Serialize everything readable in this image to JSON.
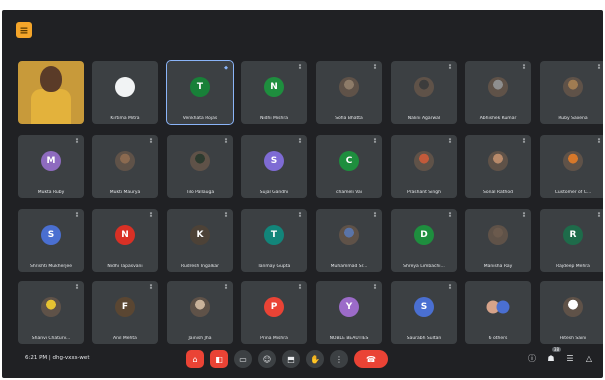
{
  "app": {
    "logo_glyph": "≡"
  },
  "participants": [
    {
      "name": "",
      "initial": "",
      "color": "",
      "type": "self",
      "mic": ""
    },
    {
      "name": "Kirtima Mitra",
      "initial": "",
      "color": "#f1f3f4",
      "type": "white",
      "mic": ""
    },
    {
      "name": "Venkhata Rojas",
      "initial": "T",
      "color": "#188038",
      "type": "initial",
      "mic": "◆",
      "active": true
    },
    {
      "name": "Nidhi Mishra",
      "initial": "N",
      "color": "#1e8e3e",
      "type": "initial",
      "mic": "⁑"
    },
    {
      "name": "Sofia Bhatta",
      "initial": "",
      "color": "#8d7b68",
      "type": "photo",
      "mic": "⁑"
    },
    {
      "name": "Nalini Agarwal",
      "initial": "",
      "color": "#3c3c3c",
      "type": "photo",
      "mic": "⁑"
    },
    {
      "name": "Abhishek Kumar",
      "initial": "",
      "color": "#8e8e8e",
      "type": "photo",
      "mic": "⁑"
    },
    {
      "name": "Ruby Saxena",
      "initial": "",
      "color": "#a07c52",
      "type": "photo",
      "mic": "⁑"
    },
    {
      "name": "Mukta Ruby",
      "initial": "M",
      "color": "#8e6bbf",
      "type": "initial",
      "mic": "⁑"
    },
    {
      "name": "Mukti Maurya",
      "initial": "",
      "color": "#8b6a50",
      "type": "photo",
      "mic": "⁑"
    },
    {
      "name": "Tilo Pallauga",
      "initial": "",
      "color": "#2d3b2f",
      "type": "photo",
      "mic": "⁑"
    },
    {
      "name": "Sujal Gandhi",
      "initial": "S",
      "color": "#7e6bd4",
      "type": "initial",
      "mic": "⁑"
    },
    {
      "name": "chameli Vai",
      "initial": "C",
      "color": "#1e8e3e",
      "type": "initial",
      "mic": "⁑"
    },
    {
      "name": "Prashant Singh",
      "initial": "",
      "color": "#c35a3a",
      "type": "photo",
      "mic": "⁑"
    },
    {
      "name": "Sonal Rathod",
      "initial": "",
      "color": "#b88a6a",
      "type": "photo",
      "mic": "⁑"
    },
    {
      "name": "Customer of C...",
      "initial": "",
      "color": "#d7782a",
      "type": "photo",
      "mic": "⁑"
    },
    {
      "name": "Shrishti Mukherjee",
      "initial": "S",
      "color": "#4a6fd1",
      "type": "initial",
      "mic": "⁑"
    },
    {
      "name": "Nidhi Tapasvani",
      "initial": "N",
      "color": "#d93025",
      "type": "initial",
      "mic": "⁑"
    },
    {
      "name": "Rudresh Ingalkar",
      "initial": "K",
      "color": "#4d4237",
      "type": "initial",
      "mic": "⁑"
    },
    {
      "name": "Tanmay Gupta",
      "initial": "T",
      "color": "#12857a",
      "type": "initial",
      "mic": "⁑"
    },
    {
      "name": "Muhammad Sr...",
      "initial": "",
      "color": "#5a74a8",
      "type": "photo",
      "mic": "⁑"
    },
    {
      "name": "Shreya Limbachi...",
      "initial": "D",
      "color": "#1e8e3e",
      "type": "initial",
      "mic": "⁑"
    },
    {
      "name": "Manisha Ray",
      "initial": "",
      "color": "#6b5a4d",
      "type": "photo",
      "mic": "⁑"
    },
    {
      "name": "Rajdeep Mehra",
      "initial": "R",
      "color": "#1e6b4a",
      "type": "initial",
      "mic": "⁑"
    },
    {
      "name": "Shanvi Chaturv...",
      "initial": "",
      "color": "#e6c232",
      "type": "photo",
      "mic": "⁑"
    },
    {
      "name": "Anil Mehta",
      "initial": "F",
      "color": "#5a4632",
      "type": "initial",
      "mic": "⁑"
    },
    {
      "name": "Jainish Jha",
      "initial": "",
      "color": "#c9b29a",
      "type": "photo",
      "mic": "⁑"
    },
    {
      "name": "Prina Mishra",
      "initial": "P",
      "color": "#ea4335",
      "type": "initial",
      "mic": "⁑"
    },
    {
      "name": "NOBLE BEAUTIES",
      "initial": "Y",
      "color": "#9c6bc9",
      "type": "initial",
      "mic": "⁑"
    },
    {
      "name": "Saurabh Sultan",
      "initial": "S",
      "color": "#4a6fd1",
      "type": "initial",
      "mic": "⁑"
    },
    {
      "name": "6 others",
      "initial": "",
      "color": "#d6a38a",
      "type": "others",
      "mic": ""
    },
    {
      "name": "Hitesh Saini",
      "initial": "",
      "color": "#ffffff",
      "type": "photo",
      "mic": ""
    }
  ],
  "bottombar": {
    "time": "6:21 PM | dhg-vxxs-wet",
    "controls": [
      {
        "name": "mic-button",
        "glyph": "⌂",
        "style": "red"
      },
      {
        "name": "camera-button",
        "glyph": "◧",
        "style": "red"
      },
      {
        "name": "captions-button",
        "glyph": "▭",
        "style": "normal"
      },
      {
        "name": "emoji-button",
        "glyph": "☺",
        "style": "normal"
      },
      {
        "name": "present-button",
        "glyph": "⬒",
        "style": "normal"
      },
      {
        "name": "raise-hand-button",
        "glyph": "✋",
        "style": "normal"
      },
      {
        "name": "more-options-button",
        "glyph": "⋮",
        "style": "normal"
      },
      {
        "name": "leave-call-button",
        "glyph": "☎",
        "style": "hang"
      }
    ],
    "right": [
      {
        "name": "info-icon",
        "glyph": "ⓘ",
        "badge": ""
      },
      {
        "name": "people-icon",
        "glyph": "☗",
        "badge": "38"
      },
      {
        "name": "chat-icon",
        "glyph": "☰",
        "badge": ""
      },
      {
        "name": "activities-icon",
        "glyph": "△",
        "badge": ""
      }
    ]
  }
}
